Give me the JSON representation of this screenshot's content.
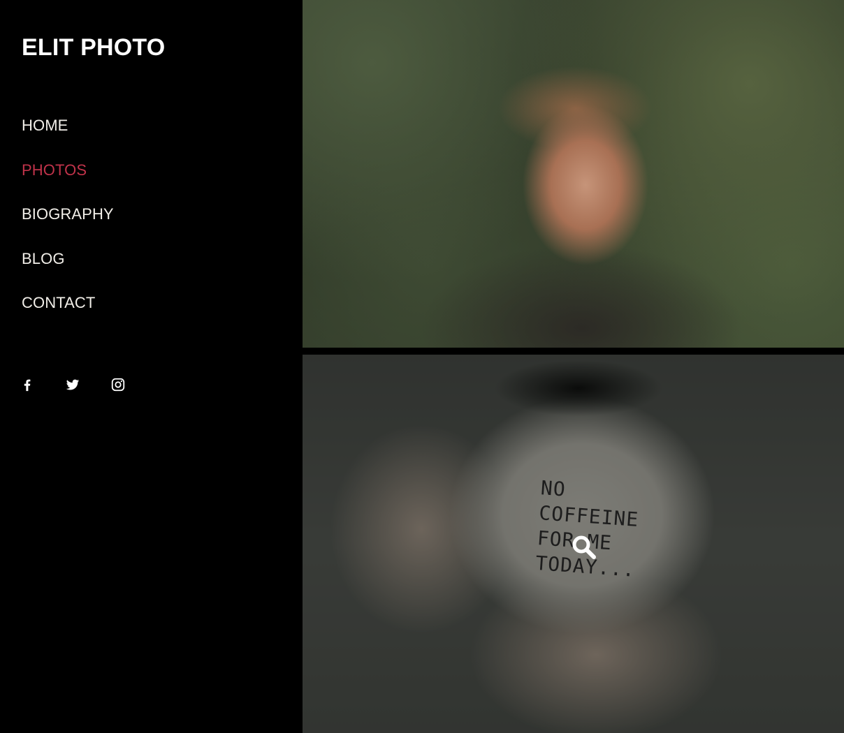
{
  "site": {
    "logo": "ELIT PHOTO"
  },
  "nav": {
    "items": [
      {
        "label": "HOME",
        "active": false
      },
      {
        "label": "PHOTOS",
        "active": true
      },
      {
        "label": "BIOGRAPHY",
        "active": false
      },
      {
        "label": "BLOG",
        "active": false
      },
      {
        "label": "CONTACT",
        "active": false
      }
    ]
  },
  "social": [
    {
      "icon": "facebook-icon"
    },
    {
      "icon": "twitter-icon"
    },
    {
      "icon": "instagram-icon"
    }
  ],
  "gallery": {
    "photos": [
      {
        "subject": "portrait-man-plants"
      },
      {
        "subject": "hands-holding-mug",
        "mug_text": [
          "NO",
          "COFFEINE",
          "FOR ME",
          "TODAY..."
        ],
        "overlay_icon": "zoom-icon"
      }
    ]
  },
  "colors": {
    "background": "#000000",
    "nav_text": "#f2efe9",
    "nav_active": "#c0334a",
    "logo": "#ffffff"
  }
}
